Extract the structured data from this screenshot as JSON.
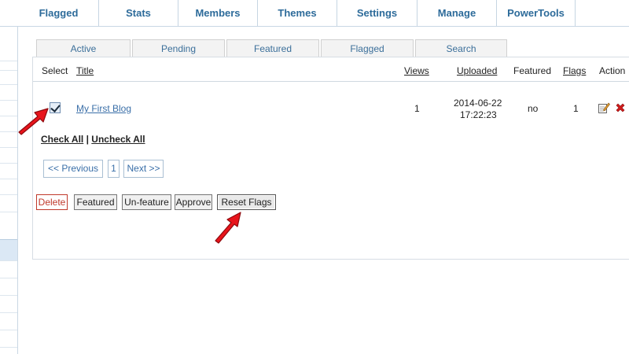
{
  "nav": {
    "items": [
      {
        "label": "Flagged"
      },
      {
        "label": "Stats"
      },
      {
        "label": "Members"
      },
      {
        "label": "Themes"
      },
      {
        "label": "Settings"
      },
      {
        "label": "Manage"
      },
      {
        "label": "PowerTools"
      }
    ]
  },
  "tabs": [
    {
      "label": "Active"
    },
    {
      "label": "Pending"
    },
    {
      "label": "Featured"
    },
    {
      "label": "Flagged"
    },
    {
      "label": "Search"
    }
  ],
  "table": {
    "headers": {
      "select": "Select",
      "title": "Title",
      "views": "Views",
      "uploaded": "Uploaded",
      "featured": "Featured",
      "flags": "Flags",
      "action": "Action"
    },
    "rows": [
      {
        "title": "My First Blog",
        "views": "1",
        "uploaded_date": "2014-06-22",
        "uploaded_time": "17:22:23",
        "featured": "no",
        "flags": "1",
        "checked": true
      }
    ]
  },
  "selection": {
    "check_all": "Check All",
    "separator": "|",
    "uncheck_all": "Uncheck All"
  },
  "pagination": {
    "previous": "<< Previous",
    "current_page": "1",
    "next": "Next >>"
  },
  "buttons": {
    "delete": "Delete",
    "featured": "Featured",
    "unfeature": "Un-feature",
    "approve": "Approve",
    "reset_flags": "Reset Flags"
  },
  "colors": {
    "nav_text": "#2d6b9a",
    "link": "#3a6fa8",
    "delete": "#c0392b",
    "arrow": "#e8141b"
  }
}
